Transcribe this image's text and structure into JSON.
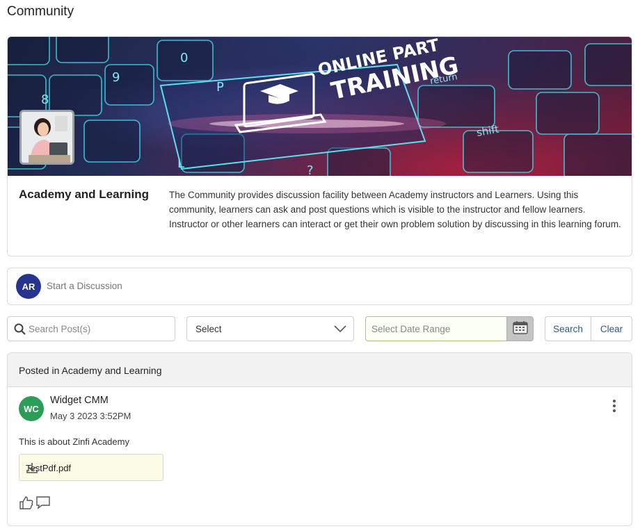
{
  "page": {
    "title": "Community"
  },
  "banner": {
    "image_text_line1": "ONLINE PART",
    "image_text_line2": "TRAINING",
    "image_key_text": "shift",
    "image_key_text2": "return"
  },
  "community": {
    "name": "Academy and Learning",
    "description": "The Community provides discussion facility between Academy instructors and Learners. Using this community, learners can ask and post questions which is visible to the instructor and fellow learners. Instructor or other learners can interact or get their own problem solution by discussing in this learning forum."
  },
  "discussion": {
    "user_initials": "AR",
    "placeholder": "Start a Discussion"
  },
  "filters": {
    "search_placeholder": "Search Post(s)",
    "select_value": "Select",
    "date_placeholder": "Select Date Range",
    "search_button": "Search",
    "clear_button": "Clear"
  },
  "post": {
    "posted_in": "Posted in Academy and Learning",
    "author_initials": "WC",
    "author": "Widget CMM",
    "timestamp": "May 3 2023 3:52PM",
    "body": "This is about Zinfi Academy",
    "attachment_name": "TestPdf.pdf"
  },
  "colors": {
    "user_avatar": "#26348f",
    "author_avatar": "#2a9d56",
    "link_blue": "#2a5a85",
    "attachment_bg": "#fbfbe6"
  },
  "icons": [
    "search-icon",
    "chevron-down-icon",
    "calendar-icon",
    "kebab-menu-icon",
    "download-icon",
    "thumbs-up-icon",
    "comment-icon"
  ]
}
